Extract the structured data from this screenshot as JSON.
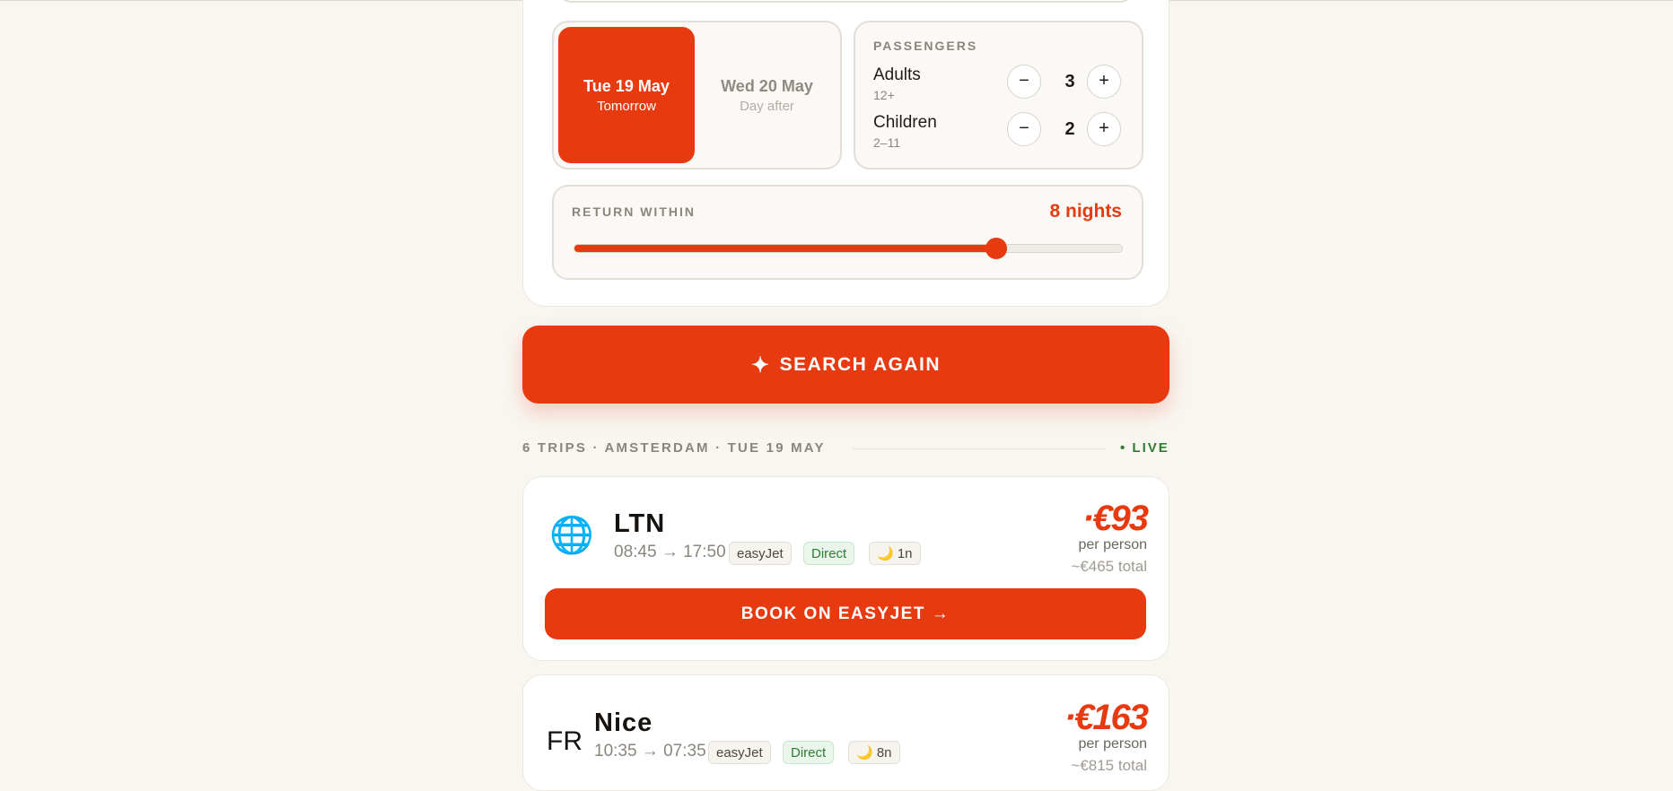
{
  "date_picker": {
    "selected": {
      "title": "Tue 19 May",
      "subtitle": "Tomorrow"
    },
    "other": {
      "title": "Wed 20 May",
      "subtitle": "Day after"
    }
  },
  "passengers": {
    "label": "PASSENGERS",
    "rows": [
      {
        "name": "Adults",
        "age": "12+",
        "count": "3"
      },
      {
        "name": "Children",
        "age": "2–11",
        "count": "2"
      }
    ],
    "minus": "−",
    "plus": "+"
  },
  "return_within": {
    "label": "RETURN WITHIN",
    "value_text": "8 nights",
    "slider_fraction": 0.77
  },
  "search_button": {
    "icon": "sparkle-icon",
    "label": "SEARCH AGAIN"
  },
  "results_header": {
    "meta": "6 TRIPS · AMSTERDAM · TUE 19 MAY",
    "live": "• LIVE"
  },
  "trips": [
    {
      "icon": "🌐",
      "destination": "LTN",
      "times": "08:45 → 17:50",
      "airline": "easyJet",
      "stops": "Direct",
      "nights": "🌙 1n",
      "price": "·€93",
      "per_person": "per person",
      "total": "~€465 total",
      "book_label": "BOOK ON EASYJET →"
    },
    {
      "icon": "FR",
      "destination": "Nice",
      "times": "10:35 → 07:35",
      "airline": "easyJet",
      "stops": "Direct",
      "nights": "🌙 8n",
      "price": "·€163",
      "per_person": "per person",
      "total": "~€815 total"
    }
  ],
  "colors": {
    "accent": "#e83a10",
    "live_green": "#2e7d32",
    "background": "#f8f6f1"
  }
}
